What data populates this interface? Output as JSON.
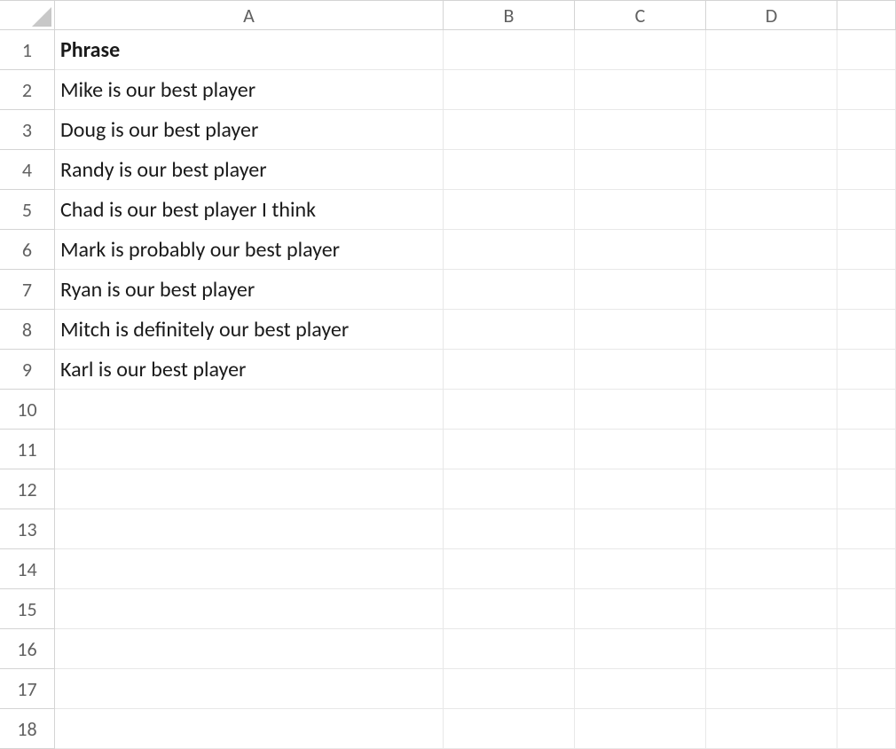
{
  "columns": [
    "A",
    "B",
    "C",
    "D",
    ""
  ],
  "rowNumbers": [
    "1",
    "2",
    "3",
    "4",
    "5",
    "6",
    "7",
    "8",
    "9",
    "10",
    "11",
    "12",
    "13",
    "14",
    "15",
    "16",
    "17",
    "18"
  ],
  "cells": {
    "A1": "Phrase",
    "A2": "Mike is our best player",
    "A3": "Doug is our best player",
    "A4": "Randy is our best player",
    "A5": "Chad is our best player I think",
    "A6": "Mark is probably our best player",
    "A7": "Ryan is our best player",
    "A8": "Mitch is definitely our best player",
    "A9": "Karl is our best player"
  }
}
